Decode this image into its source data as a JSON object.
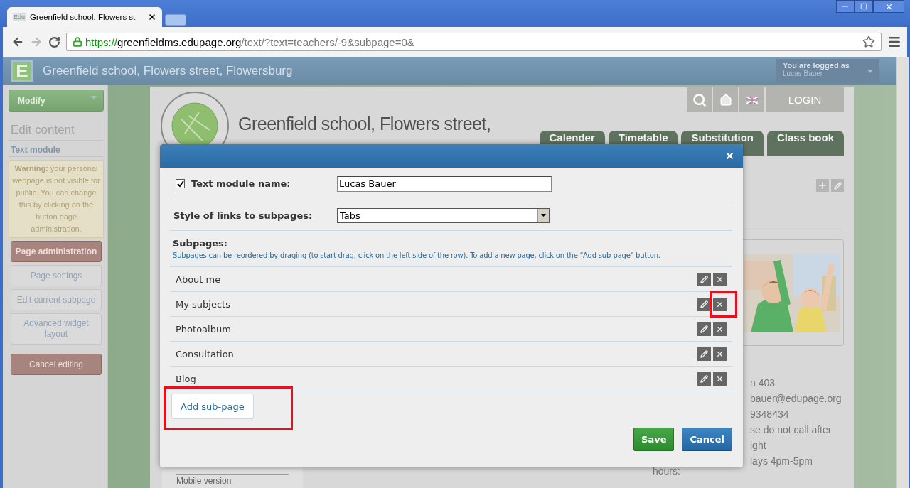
{
  "browser": {
    "tab_favicon": "Edu",
    "tab_title": "Greenfield school, Flowers st",
    "url_scheme": "https://",
    "url_host": "greenfieldms.edupage.org",
    "url_path": "/text/?text=teachers/-9&subpage=0&"
  },
  "site_header": {
    "logo_letter": "E",
    "title": "Greenfield school, Flowers street, Flowersburg",
    "logged_as_label": "You are logged as",
    "user": "Lucas Bauer"
  },
  "sidebar": {
    "modify": "Modify",
    "heading": "Edit content",
    "section": "Text module",
    "warning": "**Warning:** your personal webpage is not visible for public. You can change this by clicking on the button page administration.",
    "buttons": [
      {
        "label": "Page administration",
        "kind": "primary"
      },
      {
        "label": "Page settings",
        "kind": "plain"
      },
      {
        "label": "Edit current subpage",
        "kind": "plain"
      },
      {
        "label": "Advanced widget layout",
        "kind": "plain"
      },
      {
        "label": "Cancel editing",
        "kind": "primary"
      }
    ]
  },
  "page": {
    "school_title": "Greenfield school, Flowers street,",
    "login": "LOGIN",
    "nav_tabs": [
      "Calender",
      "Timetable",
      "Substitution",
      "Class book"
    ],
    "contact": [
      {
        "value": "n 403"
      },
      {
        "value": "bauer@edupage.org"
      },
      {
        "value": "9348434"
      },
      {
        "value": "se do not call after"
      },
      {
        "value": "ight"
      },
      {
        "label": "hours:",
        "value": "lays 4pm-5pm"
      }
    ],
    "footer_link": "Mobile version"
  },
  "dialog": {
    "name_field": {
      "checked": true,
      "label": "Text module name:",
      "value": "Lucas Bauer"
    },
    "style_field": {
      "label": "Style of links to subpages:",
      "value": "Tabs"
    },
    "subpages_title": "Subpages:",
    "subpages_hint": "Subpages can be reordered by draging (to start drag, click on the left side of the row). To add a new page, click on the \"Add sub-page\" button.",
    "subpages": [
      {
        "name": "About me",
        "delete_highlighted": false
      },
      {
        "name": "My subjects",
        "delete_highlighted": true
      },
      {
        "name": "Photoalbum",
        "delete_highlighted": false
      },
      {
        "name": "Consultation",
        "delete_highlighted": false
      },
      {
        "name": "Blog",
        "delete_highlighted": false
      }
    ],
    "add_button": {
      "label": "Add sub-page",
      "highlighted": true
    },
    "save": "Save",
    "cancel": "Cancel"
  }
}
